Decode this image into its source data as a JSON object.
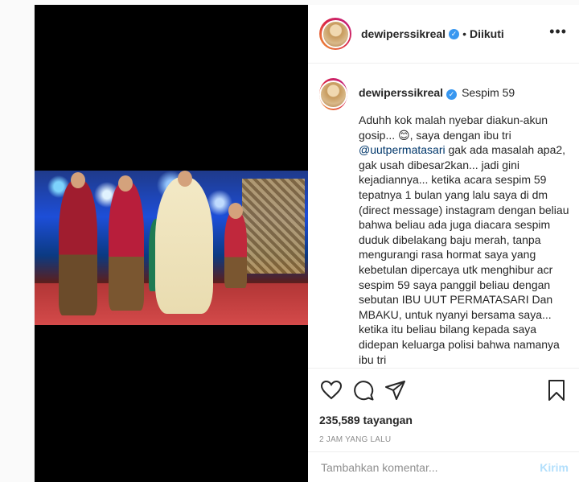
{
  "header": {
    "username": "dewiperssikreal",
    "verified_icon": "verified-badge-icon",
    "separator": "•",
    "follow_state": "Diikuti",
    "more_icon": "more-options-icon"
  },
  "caption": {
    "username": "dewiperssikreal",
    "location": "Sespim 59",
    "text_before_mention": "Aduhh kok malah nyebar diakun-akun gosip... 😊, saya dengan ibu tri ",
    "mention": "@uutpermatasari",
    "text_after_mention": " gak ada masalah apa2, gak usah dibesar2kan... jadi gini kejadiannya... ketika acara sespim 59 tepatnya 1 bulan yang lalu saya di dm (direct message) instagram dengan beliau bahwa beliau ada juga diacara sespim duduk dibelakang baju merah, tanpa mengurangi rasa hormat saya yang kebetulan dipercaya utk menghibur acr sespim 59 saya panggil beliau dengan sebutan IBU UUT PERMATASARI Dan MBAKU, untuk nyanyi bersama saya... ketika itu beliau bilang kepada saya didepan keluarga polisi bahwa namanya ibu tri"
  },
  "actions": {
    "like_icon": "heart-icon",
    "comment_icon": "comment-icon",
    "share_icon": "share-icon",
    "save_icon": "bookmark-icon",
    "views": "235,589 tayangan",
    "time": "2 JAM YANG LALU"
  },
  "comment_box": {
    "placeholder": "Tambahkan komentar...",
    "send_label": "Kirim"
  },
  "colors": {
    "link": "#00376b",
    "verified": "#3897f0",
    "send_disabled": "#b2dffc",
    "muted": "#8e8e8e"
  }
}
